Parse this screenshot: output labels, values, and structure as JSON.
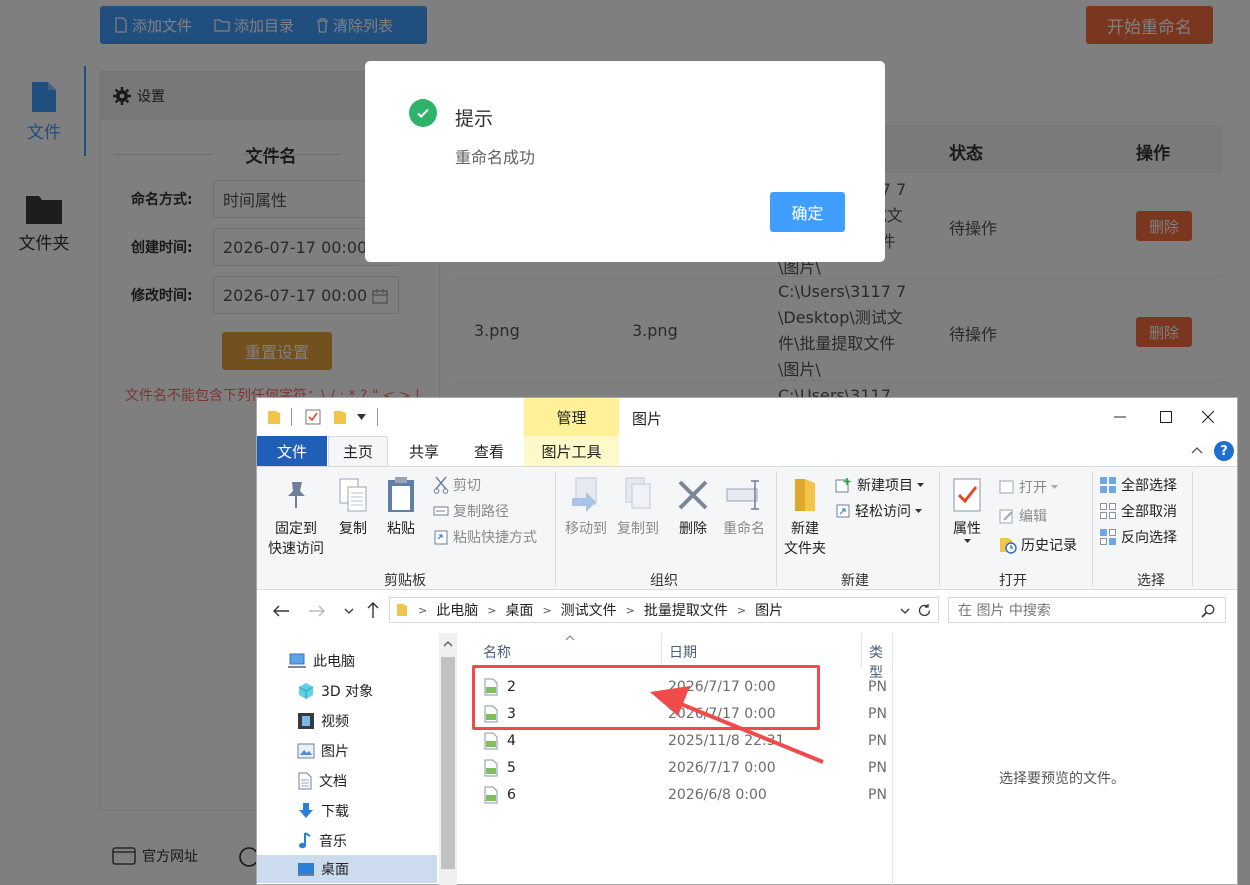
{
  "toolbar": {
    "add_file": "添加文件",
    "add_folder": "添加目录",
    "clear_list": "清除列表",
    "start_rename": "开始重命名"
  },
  "nav": {
    "file": "文件",
    "folder": "文件夹"
  },
  "settings": {
    "header": "设置",
    "section_title": "文件名",
    "naming_label": "命名方式:",
    "naming_value": "时间属性",
    "create_time_label": "创建时间:",
    "create_time_value": "2026-07-17 00:00",
    "modify_time_label": "修改时间:",
    "modify_time_value": "2026-07-17 00:00",
    "reset_button": "重置设置",
    "warning": "文件名不能包含下列任何字符：\\ / : * ? \" < > |",
    "footer_link": "官方网址"
  },
  "table": {
    "col_status": "状态",
    "col_action": "操作",
    "rows": [
      {
        "path_visible": "C:\\Users\\3117 7\\Desktop\\测试文件\\批量提取文件\\图片\\",
        "status": "待操作",
        "action": "删除"
      },
      {
        "original": "3.png",
        "new_name": "3.png",
        "path": "C:\\Users\\3117 7\\Desktop\\测试文件\\批量提取文件\\图片\\",
        "status": "待操作",
        "action": "删除"
      }
    ],
    "partial_path": "C:\\Users\\3117"
  },
  "dialog": {
    "title": "提示",
    "message": "重命名成功",
    "ok": "确定"
  },
  "explorer": {
    "tool_tab_caption": "管理",
    "title": "图片",
    "tabs": {
      "file": "文件",
      "home": "主页",
      "share": "共享",
      "view": "查看",
      "picture_tools": "图片工具"
    },
    "ribbon": {
      "pin": "固定到\n快速访问",
      "copy": "复制",
      "paste": "粘贴",
      "cut": "剪切",
      "copy_path": "复制路径",
      "paste_shortcut": "粘贴快捷方式",
      "group_clipboard": "剪贴板",
      "move_to": "移动到",
      "copy_to": "复制到",
      "delete": "删除",
      "rename": "重命名",
      "group_organize": "组织",
      "new_item": "新建项目",
      "easy_access": "轻松访问",
      "new_folder": "新建\n文件夹",
      "group_new": "新建",
      "properties": "属性",
      "open": "打开",
      "edit": "编辑",
      "history": "历史记录",
      "group_open": "打开",
      "select_all": "全部选择",
      "select_none": "全部取消",
      "invert_selection": "反向选择",
      "group_select": "选择"
    },
    "breadcrumb": [
      "此电脑",
      "桌面",
      "测试文件",
      "批量提取文件",
      "图片"
    ],
    "search_placeholder": "在 图片 中搜索",
    "tree": [
      "此电脑",
      "3D 对象",
      "视频",
      "图片",
      "文档",
      "下载",
      "音乐",
      "桌面"
    ],
    "columns": {
      "name": "名称",
      "date": "日期",
      "type": "类型"
    },
    "files": [
      {
        "name": "2",
        "date": "2026/7/17 0:00",
        "type": "PN"
      },
      {
        "name": "3",
        "date": "2026/7/17 0:00",
        "type": "PN"
      },
      {
        "name": "4",
        "date": "2025/11/8 22:31",
        "type": "PN"
      },
      {
        "name": "5",
        "date": "2026/7/17 0:00",
        "type": "PN"
      },
      {
        "name": "6",
        "date": "2026/6/8 0:00",
        "type": "PN"
      }
    ],
    "preview_text": "选择要预览的文件。"
  },
  "colors": {
    "primary": "#409eff",
    "danger": "#f56c3c",
    "warning": "#e6a23c",
    "success": "#2fb36a",
    "annotation": "#ef4b4b"
  }
}
